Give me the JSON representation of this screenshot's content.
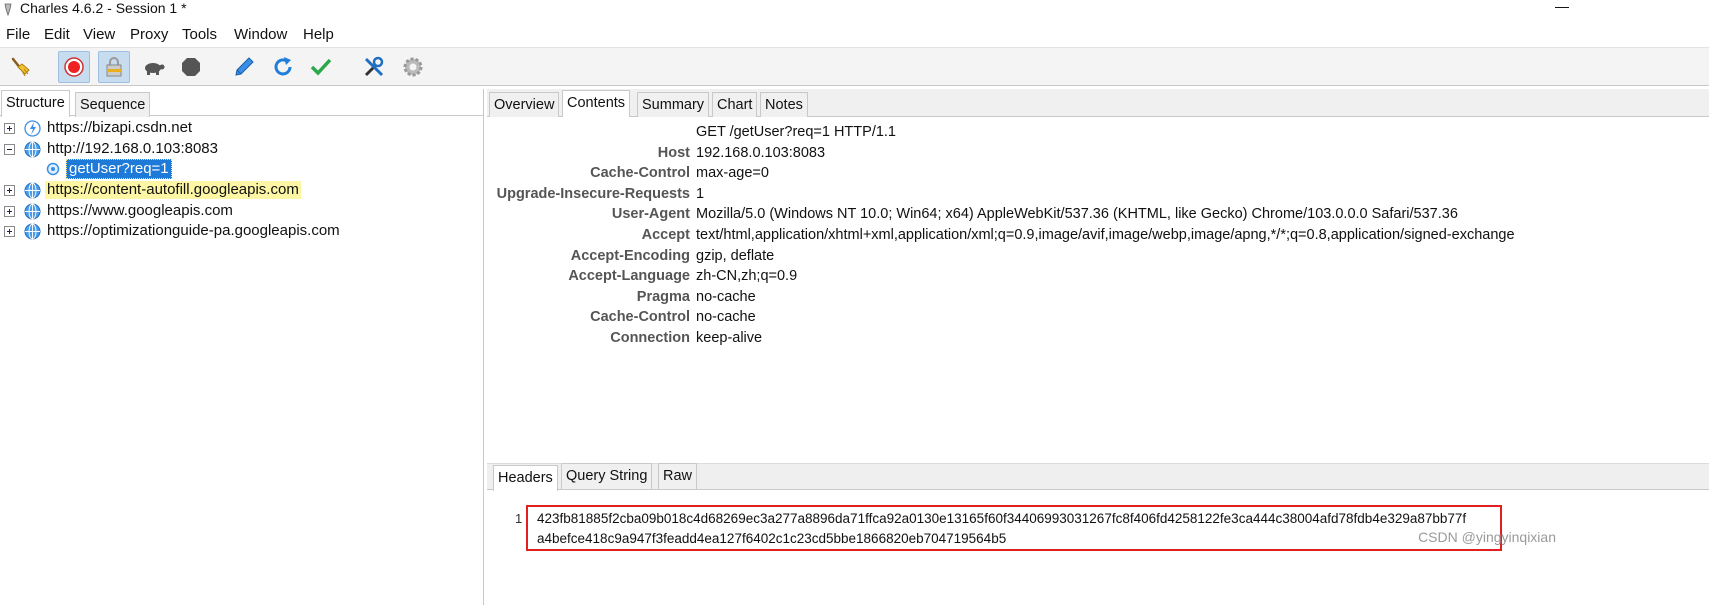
{
  "window": {
    "title": "Charles 4.6.2 - Session 1 *",
    "minimize_glyph": "—"
  },
  "menu": {
    "items": [
      "File",
      "Edit",
      "View",
      "Proxy",
      "Tools",
      "Window",
      "Help"
    ]
  },
  "toolbar": {
    "buttons": [
      "broom-icon",
      "record-icon",
      "ssl-lock-icon",
      "throttle-turtle-icon",
      "breakpoint-stop-icon",
      "compose-pen-icon",
      "repeat-refresh-icon",
      "validate-check-icon",
      "tools-icon",
      "settings-gear-icon"
    ]
  },
  "left": {
    "tabs": [
      "Structure",
      "Sequence"
    ],
    "tree": [
      {
        "label": "https://bizapi.csdn.net",
        "expanded": false,
        "icon": "lightning-globe-icon"
      },
      {
        "label": "http://192.168.0.103:8083",
        "expanded": true,
        "icon": "globe-icon"
      },
      {
        "label": "getUser?req=1",
        "icon": "request-icon",
        "selected": true
      },
      {
        "label": "https://content-autofill.googleapis.com",
        "expanded": false,
        "icon": "globe-icon",
        "highlight": true
      },
      {
        "label": "https://www.googleapis.com",
        "expanded": false,
        "icon": "globe-icon"
      },
      {
        "label": "https://optimizationguide-pa.googleapis.com",
        "expanded": false,
        "icon": "globe-icon"
      }
    ]
  },
  "right": {
    "tabs": [
      "Overview",
      "Contents",
      "Summary",
      "Chart",
      "Notes"
    ],
    "selected_tab": "Contents",
    "request_line": "GET /getUser?req=1 HTTP/1.1",
    "headers": [
      {
        "name": "Host",
        "value": "192.168.0.103:8083"
      },
      {
        "name": "Cache-Control",
        "value": "max-age=0"
      },
      {
        "name": "Upgrade-Insecure-Requests",
        "value": "1"
      },
      {
        "name": "User-Agent",
        "value": "Mozilla/5.0 (Windows NT 10.0; Win64; x64) AppleWebKit/537.36 (KHTML, like Gecko) Chrome/103.0.0.0 Safari/537.36"
      },
      {
        "name": "Accept",
        "value": "text/html,application/xhtml+xml,application/xml;q=0.9,image/avif,image/webp,image/apng,*/*;q=0.8,application/signed-exchange"
      },
      {
        "name": "Accept-Encoding",
        "value": "gzip, deflate"
      },
      {
        "name": "Accept-Language",
        "value": "zh-CN,zh;q=0.9"
      },
      {
        "name": "Pragma",
        "value": "no-cache"
      },
      {
        "name": "Cache-Control",
        "value": "no-cache"
      },
      {
        "name": "Connection",
        "value": "keep-alive"
      }
    ],
    "subtabs": [
      "Headers",
      "Query String",
      "Raw"
    ],
    "selected_subtab": "Headers",
    "body": {
      "line_number": "1",
      "lines": [
        "423fb81885f2cba09b018c4d68269ec3a277a8896da71ffca92a0130e13165f60f34406993031267fc8f406fd4258122fe3ca444c38004afd78fdb4e329a87bb77f",
        "a4befce418c9a947f3feadd4ea127f6402c1c23cd5bbe1866820eb704719564b5"
      ]
    }
  },
  "watermark": "CSDN @yingyinqixian",
  "colors": {
    "selection": "#1d7ad8",
    "highlight": "#fdf7a5",
    "annotation": "#e02020"
  }
}
